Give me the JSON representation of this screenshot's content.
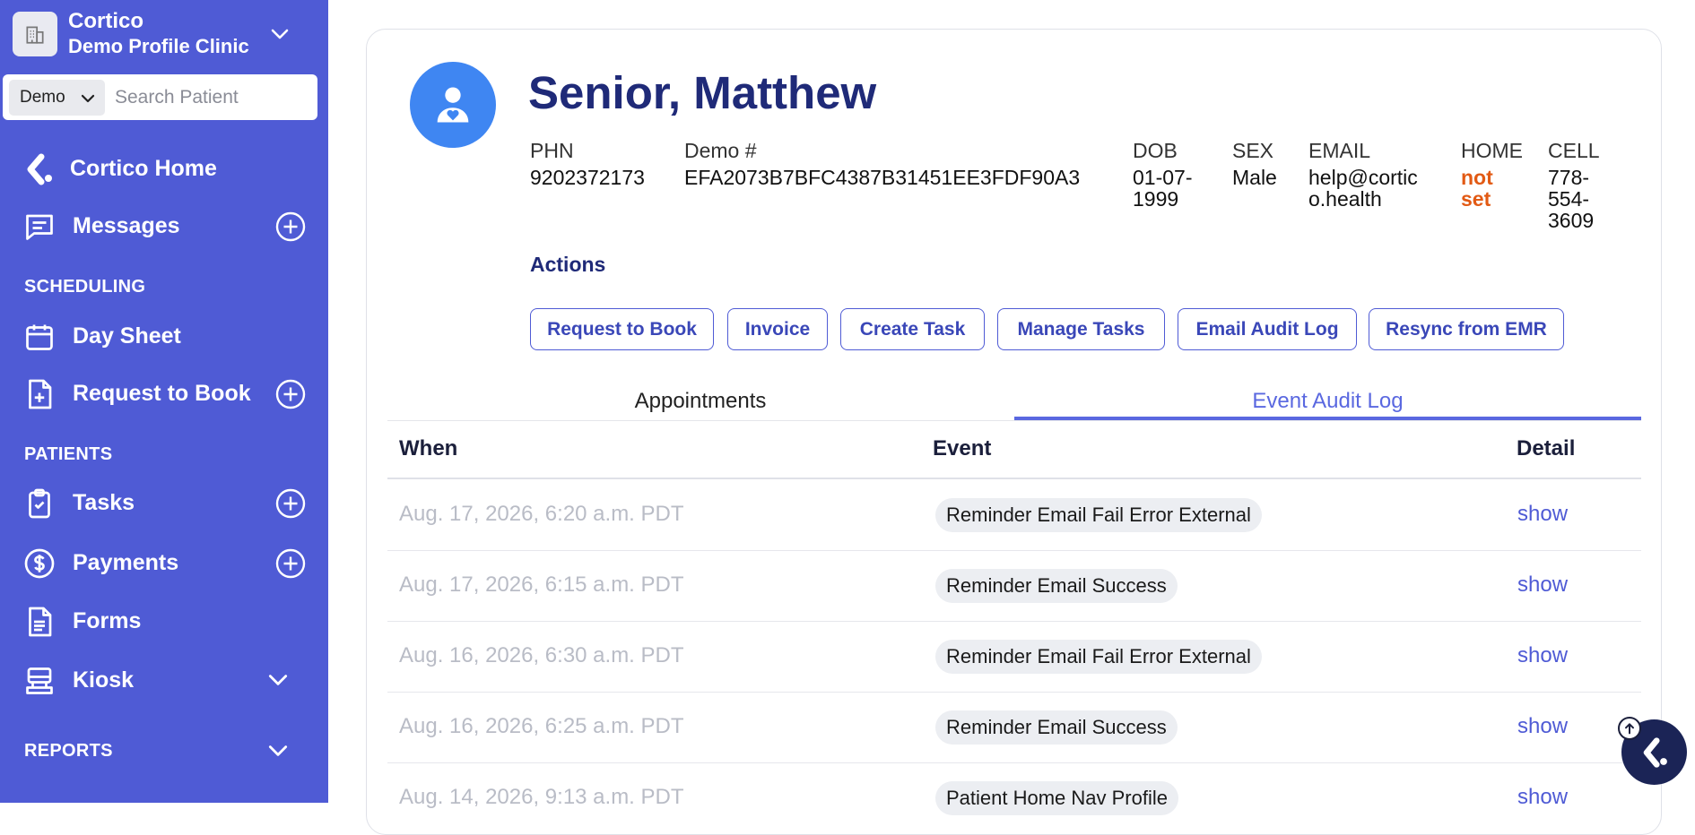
{
  "sidebar": {
    "org_name": "Cortico",
    "clinic_name": "Demo Profile Clinic",
    "search_select_value": "Demo",
    "search_placeholder": "Search Patient",
    "items": {
      "home": "Cortico Home",
      "messages": "Messages",
      "day_sheet": "Day Sheet",
      "request_to_book": "Request to Book",
      "tasks": "Tasks",
      "payments": "Payments",
      "forms": "Forms",
      "kiosk": "Kiosk"
    },
    "sections": {
      "scheduling": "SCHEDULING",
      "patients": "PATIENTS",
      "reports": "REPORTS"
    }
  },
  "patient": {
    "name": "Senior, Matthew",
    "fields": {
      "phn_label": "PHN",
      "phn_value": "9202372173",
      "demo_label": "Demo #",
      "demo_value": "EFA2073B7BFC4387B31451EE3FDF90A3",
      "dob_label": "DOB",
      "dob_line1": "01-07-",
      "dob_line2": "1999",
      "sex_label": "SEX",
      "sex_value": "Male",
      "email_label": "EMAIL",
      "email_line1": "help@cortic",
      "email_line2": "o.health",
      "home_label": "HOME",
      "home_line1": "not",
      "home_line2": "set",
      "cell_label": "CELL",
      "cell_line1": "778-",
      "cell_line2": "554-",
      "cell_line3": "3609"
    }
  },
  "actions": {
    "title": "Actions",
    "request_to_book": "Request to Book",
    "invoice": "Invoice",
    "create_task": "Create Task",
    "manage_tasks": "Manage Tasks",
    "email_audit_log": "Email Audit Log",
    "resync_from_emr": "Resync from EMR"
  },
  "tabs": {
    "appointments": "Appointments",
    "event_audit_log": "Event Audit Log",
    "active": "event_audit_log"
  },
  "table": {
    "headers": {
      "when": "When",
      "event": "Event",
      "detail": "Detail"
    },
    "rows": [
      {
        "when": "Aug. 17, 2026, 6:20 a.m. PDT",
        "event": "Reminder Email Fail Error External",
        "detail": "show"
      },
      {
        "when": "Aug. 17, 2026, 6:15 a.m. PDT",
        "event": "Reminder Email Success",
        "detail": "show"
      },
      {
        "when": "Aug. 16, 2026, 6:30 a.m. PDT",
        "event": "Reminder Email Fail Error External",
        "detail": "show"
      },
      {
        "when": "Aug. 16, 2026, 6:25 a.m. PDT",
        "event": "Reminder Email Success",
        "detail": "show"
      },
      {
        "when": "Aug. 14, 2026, 9:13 a.m. PDT",
        "event": "Patient Home Nav Profile",
        "detail": "show"
      }
    ]
  },
  "colors": {
    "sidebar_bg": "#4f5bd5",
    "title_navy": "#1f2a78",
    "accent": "#5a68e0",
    "warning": "#e25a14"
  }
}
